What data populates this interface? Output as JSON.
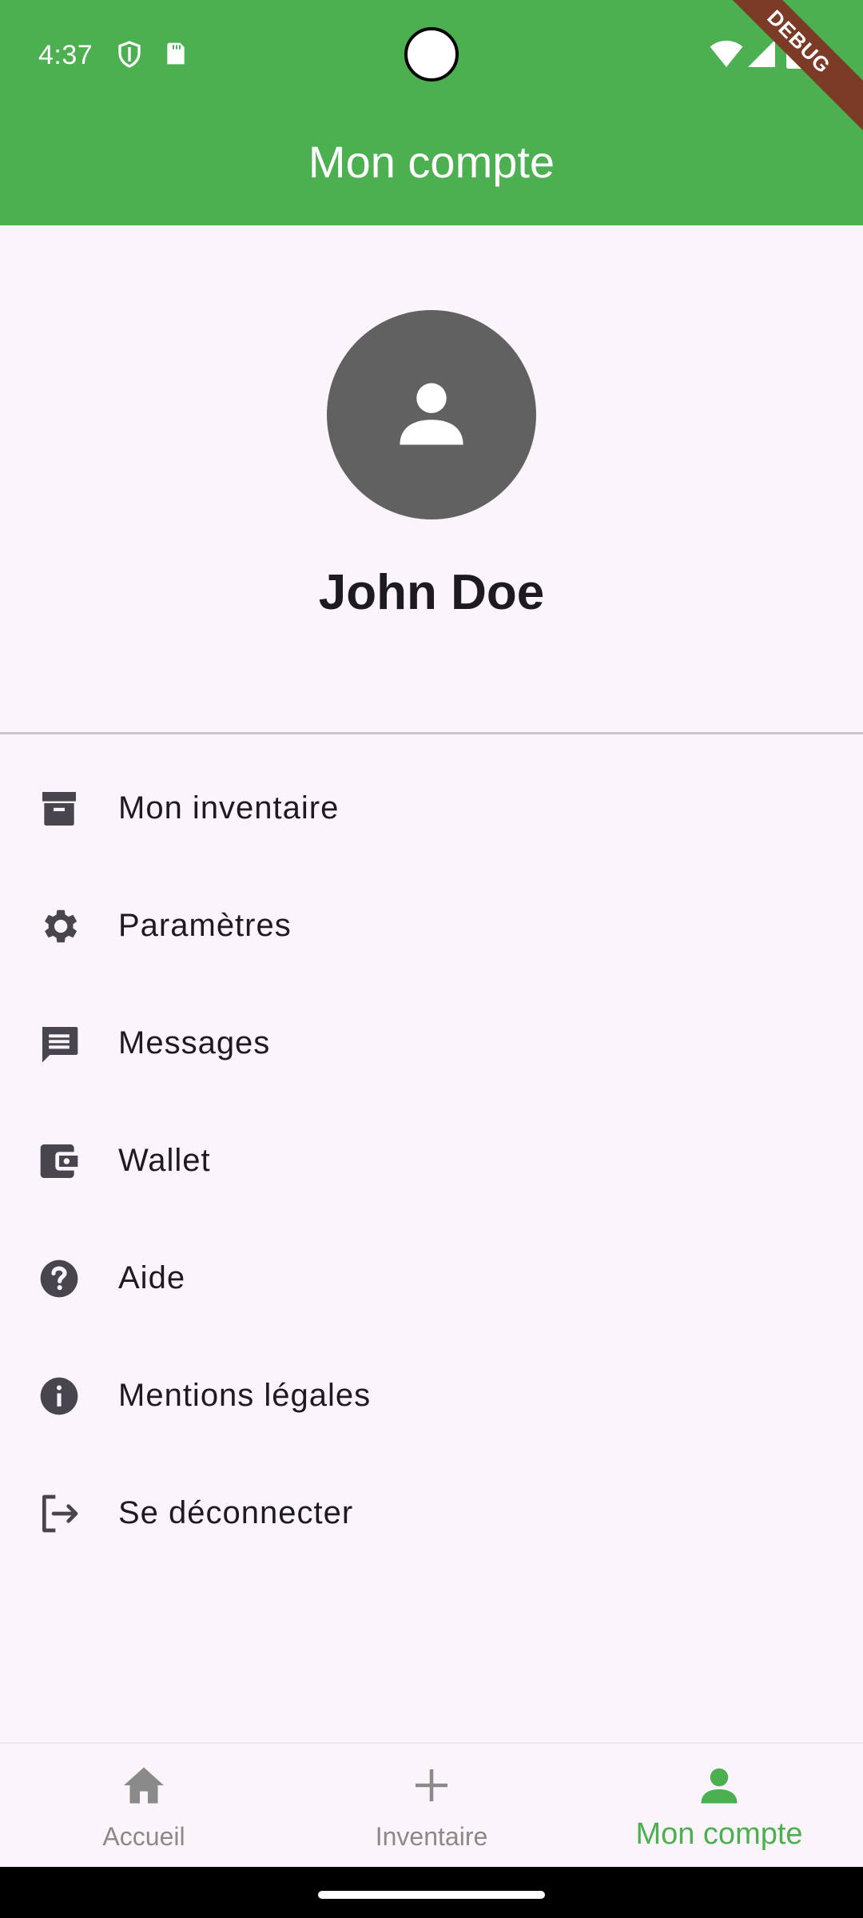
{
  "status_bar": {
    "time": "4:37",
    "icons": [
      "shield-icon",
      "sd-card-icon",
      "wifi-icon",
      "cell-signal-icon",
      "battery-icon"
    ],
    "debug_banner": "DEBUG"
  },
  "app_bar": {
    "title": "Mon compte",
    "color": "#4caf50"
  },
  "profile": {
    "name": "John Doe",
    "avatar_icon": "person-icon"
  },
  "menu": {
    "items": [
      {
        "label": "Mon inventaire",
        "icon": "archive-icon"
      },
      {
        "label": "Paramètres",
        "icon": "gear-icon"
      },
      {
        "label": "Messages",
        "icon": "message-icon"
      },
      {
        "label": "Wallet",
        "icon": "wallet-icon"
      },
      {
        "label": "Aide",
        "icon": "help-icon"
      },
      {
        "label": "Mentions légales",
        "icon": "info-icon"
      },
      {
        "label": "Se déconnecter",
        "icon": "logout-icon"
      }
    ]
  },
  "bottom_nav": {
    "items": [
      {
        "label": "Accueil",
        "icon": "home-icon",
        "active": false
      },
      {
        "label": "Inventaire",
        "icon": "plus-icon",
        "active": false
      },
      {
        "label": "Mon compte",
        "icon": "person-icon",
        "active": true
      }
    ],
    "active_color": "#4caf50",
    "inactive_color": "#8a8a8a"
  }
}
